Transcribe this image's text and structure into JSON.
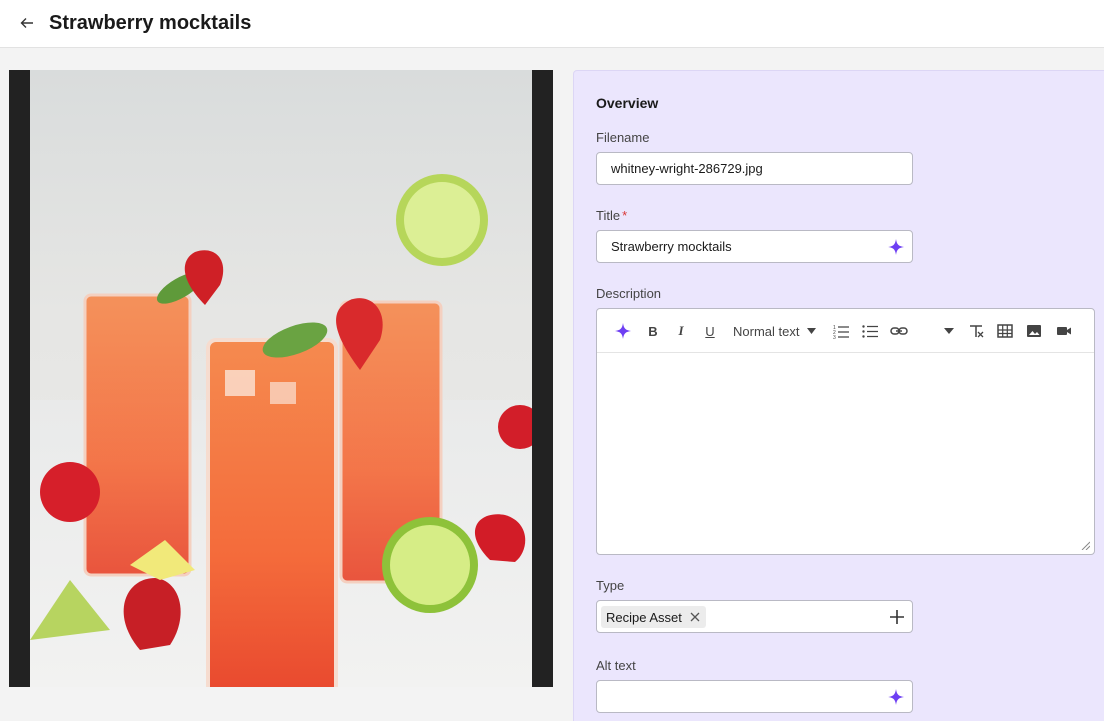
{
  "header": {
    "title": "Strawberry mocktails"
  },
  "overview": {
    "section_title": "Overview",
    "filename": {
      "label": "Filename",
      "value": "whitney-wright-286729.jpg"
    },
    "title": {
      "label": "Title",
      "required_mark": "*",
      "value": "Strawberry mocktails"
    },
    "description": {
      "label": "Description",
      "toolbar": {
        "bold": "B",
        "italic": "I",
        "underline": "U",
        "format_select": "Normal text"
      },
      "value": ""
    },
    "type": {
      "label": "Type",
      "chip": "Recipe Asset"
    },
    "alt_text": {
      "label": "Alt text",
      "value": ""
    }
  },
  "icons": [
    "back-arrow-icon",
    "sparkle-icon",
    "ordered-list-icon",
    "bullet-list-icon",
    "link-icon",
    "clear-format-icon",
    "table-icon",
    "image-icon",
    "video-icon",
    "plus-icon",
    "close-icon"
  ],
  "colors": {
    "accent": "#6e3ff3",
    "panel_bg": "#ebe6fd"
  }
}
